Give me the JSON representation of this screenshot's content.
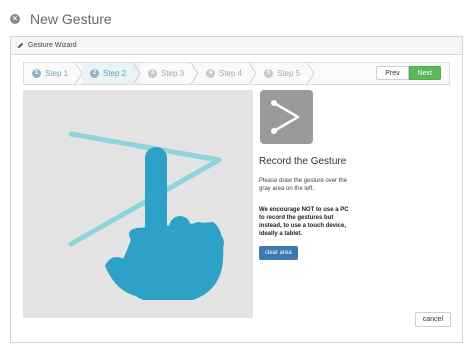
{
  "window": {
    "title": "New Gesture"
  },
  "panel": {
    "title": "Gesture Wizard"
  },
  "steps": [
    {
      "num": "1",
      "label": "Step 1",
      "state": "done"
    },
    {
      "num": "2",
      "label": "Step 2",
      "state": "active"
    },
    {
      "num": "3",
      "label": "Step 3",
      "state": "todo"
    },
    {
      "num": "4",
      "label": "Step 4",
      "state": "todo"
    },
    {
      "num": "5",
      "label": "Step 5",
      "state": "todo"
    }
  ],
  "nav": {
    "prev_label": "Prev",
    "next_label": "Next"
  },
  "record": {
    "title": "Record the Gesture",
    "instructions": "Please draw the gesture over the gray area on the left.",
    "warning": "We encourage NOT to use a PC to record the gestures but instead, to use a touch device, ideally a tablet.",
    "clear_label": "clear area"
  },
  "footer": {
    "cancel_label": "cancel"
  },
  "colors": {
    "gesture_stroke": "#8fd3dc",
    "hand": "#2ea1c8",
    "canvas_bg": "#e3e3e3",
    "next_button": "#5cb85c",
    "clear_button": "#3d7ab0"
  },
  "icons": [
    "close-icon",
    "pencil-icon",
    "gesture-preview-icon",
    "hand-icon"
  ]
}
